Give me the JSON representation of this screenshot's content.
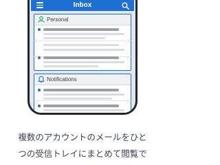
{
  "appbar": {
    "title": "Inbox",
    "menu_icon": "hamburger-menu-icon",
    "search_icon": "magnifier-search-icon",
    "color": "#1e6fd2"
  },
  "sections": [
    {
      "title": "Personal",
      "icon": "person-icon"
    },
    {
      "title": "Notifications",
      "icon": "bell-icon"
    }
  ],
  "caption": {
    "line1": "複数のアカウントのメールをひと",
    "line2": "つの受信トレイにまとめて閲覧で"
  }
}
